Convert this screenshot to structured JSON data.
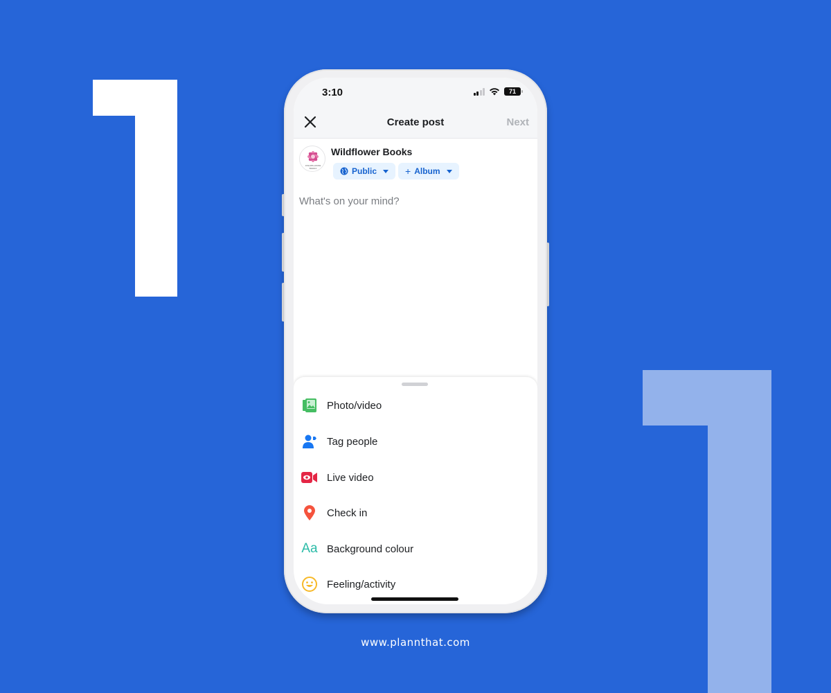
{
  "status_bar": {
    "time": "3:10",
    "battery": "71"
  },
  "nav": {
    "title": "Create post",
    "next_label": "Next"
  },
  "author": {
    "name": "Wildflower Books",
    "avatar_text": "Wildflower Books"
  },
  "chips": {
    "privacy": "Public",
    "album": "Album",
    "album_prefix": "+"
  },
  "composer": {
    "placeholder": "What's on your mind?"
  },
  "actions": [
    {
      "label": "Photo/video",
      "icon": "photo-video-icon",
      "color": "#45bd62"
    },
    {
      "label": "Tag people",
      "icon": "tag-people-icon",
      "color": "#1877f2"
    },
    {
      "label": "Live video",
      "icon": "live-video-icon",
      "color": "#e42645"
    },
    {
      "label": "Check in",
      "icon": "location-pin-icon",
      "color": "#f5533d"
    },
    {
      "label": "Background colour",
      "icon": "text-aa-icon",
      "color": "#2abba7"
    },
    {
      "label": "Feeling/activity",
      "icon": "smiley-icon",
      "color": "#f7b928"
    }
  ],
  "background_text": {
    "left_digit": "1",
    "right_digit": "1"
  },
  "footer": {
    "url": "www.plannthat.com"
  },
  "colors": {
    "background": "#2665d8",
    "accent": "#1763cf",
    "chip_bg": "#e7f3ff"
  }
}
